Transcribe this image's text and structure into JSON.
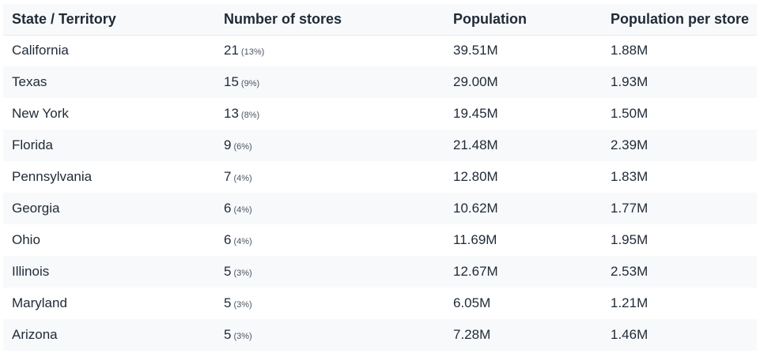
{
  "table": {
    "headers": [
      "State / Territory",
      "Number of stores",
      "Population",
      "Population per store"
    ],
    "rows": [
      {
        "state": "California",
        "stores": "21",
        "share": "(13%)",
        "population": "39.51M",
        "per_store": "1.88M"
      },
      {
        "state": "Texas",
        "stores": "15",
        "share": "(9%)",
        "population": "29.00M",
        "per_store": "1.93M"
      },
      {
        "state": "New York",
        "stores": "13",
        "share": "(8%)",
        "population": "19.45M",
        "per_store": "1.50M"
      },
      {
        "state": "Florida",
        "stores": "9",
        "share": "(6%)",
        "population": "21.48M",
        "per_store": "2.39M"
      },
      {
        "state": "Pennsylvania",
        "stores": "7",
        "share": "(4%)",
        "population": "12.80M",
        "per_store": "1.83M"
      },
      {
        "state": "Georgia",
        "stores": "6",
        "share": "(4%)",
        "population": "10.62M",
        "per_store": "1.77M"
      },
      {
        "state": "Ohio",
        "stores": "6",
        "share": "(4%)",
        "population": "11.69M",
        "per_store": "1.95M"
      },
      {
        "state": "Illinois",
        "stores": "5",
        "share": "(3%)",
        "population": "12.67M",
        "per_store": "2.53M"
      },
      {
        "state": "Maryland",
        "stores": "5",
        "share": "(3%)",
        "population": "6.05M",
        "per_store": "1.21M"
      },
      {
        "state": "Arizona",
        "stores": "5",
        "share": "(3%)",
        "population": "7.28M",
        "per_store": "1.46M"
      }
    ]
  },
  "colors": {
    "text": "#1f2a37",
    "muted": "#4b5563",
    "stripe": "#f8f9fb",
    "border": "#e5e7eb"
  }
}
